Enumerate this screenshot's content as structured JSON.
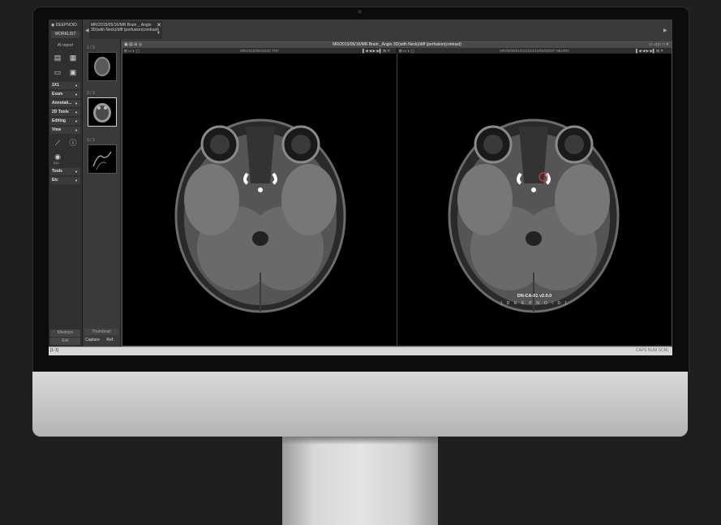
{
  "app": {
    "logo": "DEEPNOID",
    "worklist": "WORKLIST",
    "ai_report": "AI report",
    "layout_label": "1X1"
  },
  "menu": {
    "exam": "Exam",
    "annotation": "Annotati...",
    "tools_2d": "2D Tools",
    "editing": "Editing",
    "view": "View",
    "tools": "Tools",
    "etc": "Etc",
    "all": "ALL"
  },
  "sidebar_bottom": {
    "minimize": "Minimize",
    "exit": "Exit"
  },
  "thumbnails": {
    "items": [
      {
        "label": "1 / 3"
      },
      {
        "label": "2 / 3"
      },
      {
        "label": "3 / 3"
      }
    ],
    "footer": "Thumbnail",
    "capture": "Capture",
    "ref": "Ref."
  },
  "tab": {
    "title": "MR/2015/05/16/MR Brain _ Angio 3D(with Neck)/diff (perfusion(contrast)"
  },
  "viewer": {
    "title": "MR/2015/05/16/MR Brain _Angio 3D(with Neck)/diff (perfusion(contrast)",
    "left_series": "MR/2015/05/16/3D TOF",
    "right_series": "MR/0000/01/01/2024/10/06/DEEP NEURO",
    "watermark": "DN-CA-01 v2.0.0",
    "brand": "[ D E E P N O I D ]"
  },
  "statusbar": {
    "left": "[1-1]",
    "right": "CAPS NUM SCRL"
  },
  "colors": {
    "screen": "#3a3a3a",
    "image_bg": "#000000",
    "finding": "#ff3b3b"
  }
}
